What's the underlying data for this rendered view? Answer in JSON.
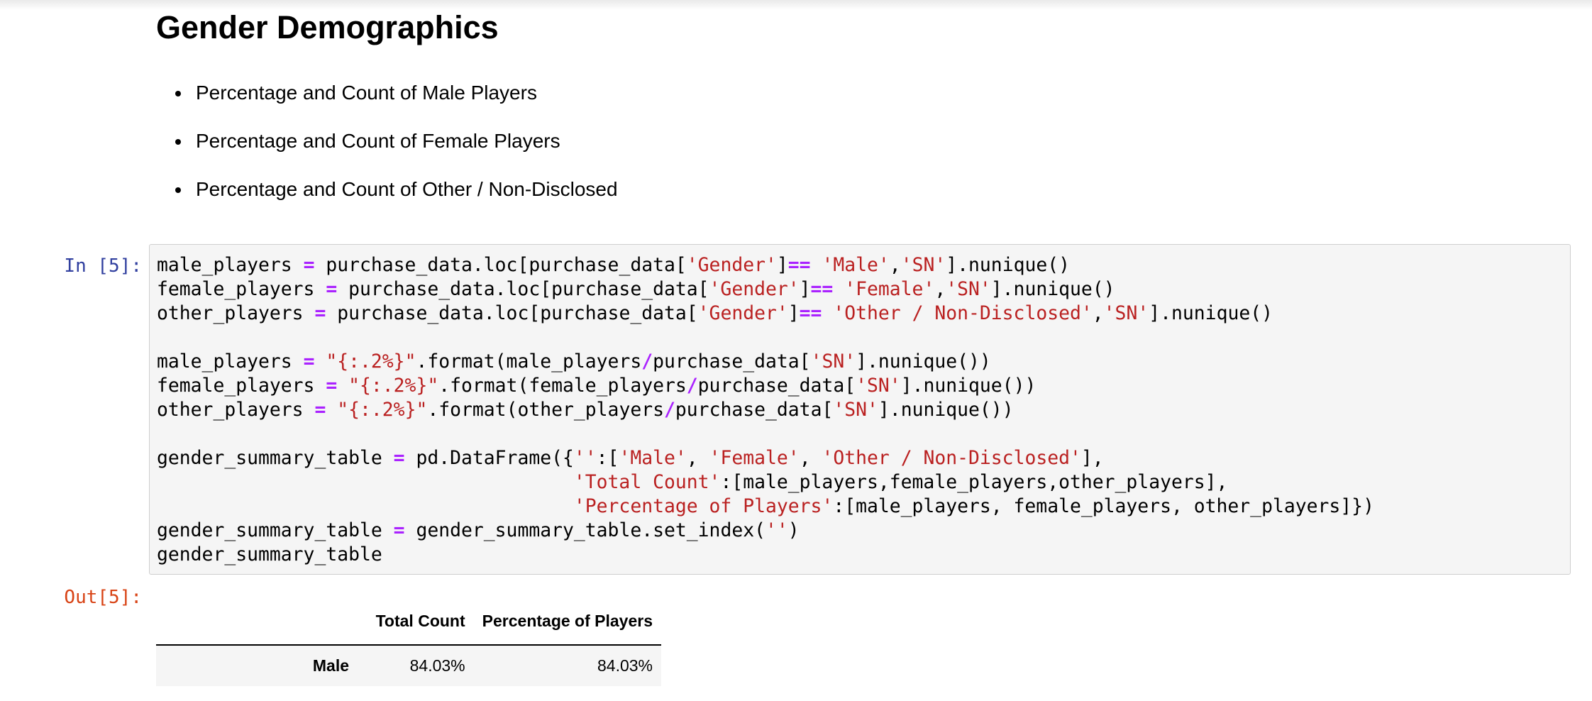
{
  "markdown": {
    "title": "Gender Demographics",
    "bullets": [
      "Percentage and Count of Male Players",
      "Percentage and Count of Female Players",
      "Percentage and Count of Other / Non-Disclosed"
    ]
  },
  "cell": {
    "in_prompt": "In [5]:",
    "out_prompt": "Out[5]:",
    "code_lines": [
      [
        [
          "male_players ",
          "plain"
        ],
        [
          "=",
          "op"
        ],
        [
          " purchase_data.loc[purchase_data[",
          "plain"
        ],
        [
          "'Gender'",
          "str"
        ],
        [
          "]",
          "plain"
        ],
        [
          "==",
          "op"
        ],
        [
          " ",
          "plain"
        ],
        [
          "'Male'",
          "str"
        ],
        [
          ",",
          "plain"
        ],
        [
          "'SN'",
          "str"
        ],
        [
          "].nunique()",
          "plain"
        ]
      ],
      [
        [
          "female_players ",
          "plain"
        ],
        [
          "=",
          "op"
        ],
        [
          " purchase_data.loc[purchase_data[",
          "plain"
        ],
        [
          "'Gender'",
          "str"
        ],
        [
          "]",
          "plain"
        ],
        [
          "==",
          "op"
        ],
        [
          " ",
          "plain"
        ],
        [
          "'Female'",
          "str"
        ],
        [
          ",",
          "plain"
        ],
        [
          "'SN'",
          "str"
        ],
        [
          "].nunique()",
          "plain"
        ]
      ],
      [
        [
          "other_players ",
          "plain"
        ],
        [
          "=",
          "op"
        ],
        [
          " purchase_data.loc[purchase_data[",
          "plain"
        ],
        [
          "'Gender'",
          "str"
        ],
        [
          "]",
          "plain"
        ],
        [
          "==",
          "op"
        ],
        [
          " ",
          "plain"
        ],
        [
          "'Other / Non-Disclosed'",
          "str"
        ],
        [
          ",",
          "plain"
        ],
        [
          "'SN'",
          "str"
        ],
        [
          "].nunique()",
          "plain"
        ]
      ],
      [],
      [
        [
          "male_players ",
          "plain"
        ],
        [
          "=",
          "op"
        ],
        [
          " ",
          "plain"
        ],
        [
          "\"{:.2%}\"",
          "str"
        ],
        [
          ".format(male_players",
          "plain"
        ],
        [
          "/",
          "op"
        ],
        [
          "purchase_data[",
          "plain"
        ],
        [
          "'SN'",
          "str"
        ],
        [
          "].nunique())",
          "plain"
        ]
      ],
      [
        [
          "female_players ",
          "plain"
        ],
        [
          "=",
          "op"
        ],
        [
          " ",
          "plain"
        ],
        [
          "\"{:.2%}\"",
          "str"
        ],
        [
          ".format(female_players",
          "plain"
        ],
        [
          "/",
          "op"
        ],
        [
          "purchase_data[",
          "plain"
        ],
        [
          "'SN'",
          "str"
        ],
        [
          "].nunique())",
          "plain"
        ]
      ],
      [
        [
          "other_players ",
          "plain"
        ],
        [
          "=",
          "op"
        ],
        [
          " ",
          "plain"
        ],
        [
          "\"{:.2%}\"",
          "str"
        ],
        [
          ".format(other_players",
          "plain"
        ],
        [
          "/",
          "op"
        ],
        [
          "purchase_data[",
          "plain"
        ],
        [
          "'SN'",
          "str"
        ],
        [
          "].nunique())",
          "plain"
        ]
      ],
      [],
      [
        [
          "gender_summary_table ",
          "plain"
        ],
        [
          "=",
          "op"
        ],
        [
          " pd.DataFrame({",
          "plain"
        ],
        [
          "''",
          "str"
        ],
        [
          ":[",
          "plain"
        ],
        [
          "'Male'",
          "str"
        ],
        [
          ", ",
          "plain"
        ],
        [
          "'Female'",
          "str"
        ],
        [
          ", ",
          "plain"
        ],
        [
          "'Other / Non-Disclosed'",
          "str"
        ],
        [
          "],",
          "plain"
        ]
      ],
      [
        [
          "                                     ",
          "plain"
        ],
        [
          "'Total Count'",
          "str"
        ],
        [
          ":[male_players,female_players,other_players],",
          "plain"
        ]
      ],
      [
        [
          "                                     ",
          "plain"
        ],
        [
          "'Percentage of Players'",
          "str"
        ],
        [
          ":[male_players, female_players, other_players]})",
          "plain"
        ]
      ],
      [
        [
          "gender_summary_table ",
          "plain"
        ],
        [
          "=",
          "op"
        ],
        [
          " gender_summary_table.set_index(",
          "plain"
        ],
        [
          "''",
          "str"
        ],
        [
          ")",
          "plain"
        ]
      ],
      [
        [
          "gender_summary_table",
          "plain"
        ]
      ]
    ]
  },
  "output": {
    "table": {
      "columns": [
        "",
        "Total Count",
        "Percentage of Players"
      ],
      "rows": [
        {
          "index": "Male",
          "total_count": "84.03%",
          "percentage": "84.03%"
        }
      ]
    }
  }
}
